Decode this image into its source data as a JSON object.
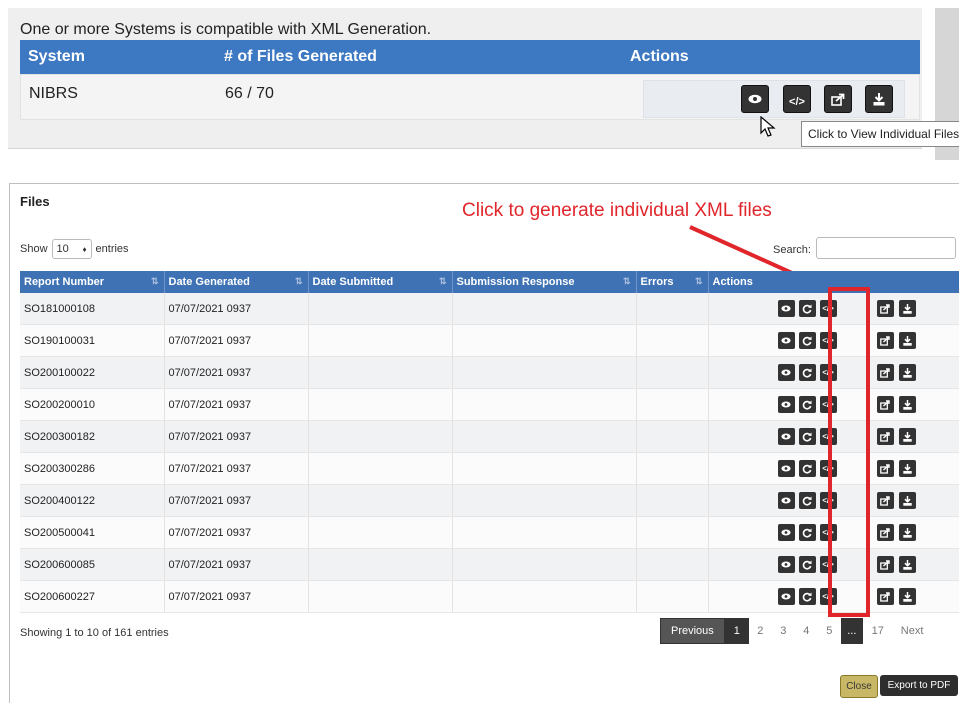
{
  "systems": {
    "message": "One or more Systems is compatible with XML Generation.",
    "columns": [
      "System",
      "# of Files Generated",
      "Actions"
    ],
    "row": {
      "system": "NIBRS",
      "files_generated": "66 / 70"
    },
    "tooltip": "Click to View Individual Files"
  },
  "files": {
    "title": "Files",
    "annotation": "Click to generate individual XML files",
    "show_label": "Show",
    "entries_value": "10",
    "entries_label": "entries",
    "search_label": "Search:",
    "columns": [
      "Report Number",
      "Date Generated",
      "Date Submitted",
      "Submission Response",
      "Errors",
      "Actions"
    ],
    "rows": [
      {
        "report": "SO181000108",
        "date": "07/07/2021 0937"
      },
      {
        "report": "SO190100031",
        "date": "07/07/2021 0937"
      },
      {
        "report": "SO200100022",
        "date": "07/07/2021 0937"
      },
      {
        "report": "SO200200010",
        "date": "07/07/2021 0937"
      },
      {
        "report": "SO200300182",
        "date": "07/07/2021 0937"
      },
      {
        "report": "SO200300286",
        "date": "07/07/2021 0937"
      },
      {
        "report": "SO200400122",
        "date": "07/07/2021 0937"
      },
      {
        "report": "SO200500041",
        "date": "07/07/2021 0937"
      },
      {
        "report": "SO200600085",
        "date": "07/07/2021 0937"
      },
      {
        "report": "SO200600227",
        "date": "07/07/2021 0937"
      }
    ],
    "showing": "Showing 1 to 10 of 161 entries",
    "pager": {
      "previous": "Previous",
      "pages": [
        "1",
        "2",
        "3",
        "4",
        "5"
      ],
      "ellipsis": "...",
      "last": "17",
      "next": "Next"
    },
    "close_label": "Close",
    "export_label": "Export to PDF"
  },
  "icons": {
    "view": "eye-icon",
    "regenerate": "refresh-icon",
    "xml": "code-icon",
    "submit": "share-icon",
    "download": "download-icon"
  },
  "colors": {
    "header_blue": "#3d78c2",
    "annotation_red": "#e0262b",
    "close_button": "#c8b765"
  }
}
